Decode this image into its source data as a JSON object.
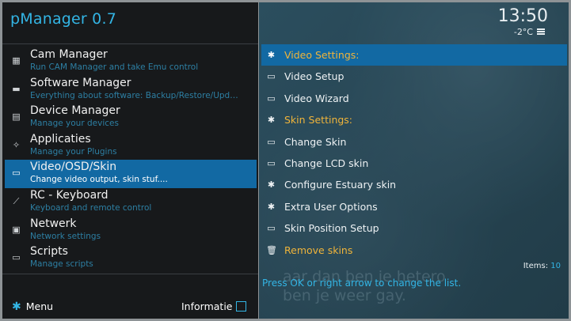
{
  "app": {
    "title": "pManager 0.7"
  },
  "status": {
    "clock": "13:50",
    "temperature": "-2°C"
  },
  "menu": [
    {
      "icon": "cam-icon",
      "title": "Cam Manager",
      "subtitle": "Run CAM Manager and take Emu control"
    },
    {
      "icon": "folder-icon",
      "title": "Software Manager",
      "subtitle": "Everything about software: Backup/Restore/Update..."
    },
    {
      "icon": "device-icon",
      "title": "Device Manager",
      "subtitle": "Manage your devices"
    },
    {
      "icon": "plugin-icon",
      "title": "Applicaties",
      "subtitle": "Manage your Plugins"
    },
    {
      "icon": "monitor-icon",
      "title": "Video/OSD/Skin",
      "subtitle": "Change video output, skin stuf....",
      "active": true
    },
    {
      "icon": "remote-icon",
      "title": "RC - Keyboard",
      "subtitle": "Keyboard and remote control"
    },
    {
      "icon": "network-icon",
      "title": "Netwerk",
      "subtitle": "Network settings"
    },
    {
      "icon": "script-icon",
      "title": "Scripts",
      "subtitle": "Manage scripts"
    }
  ],
  "footer": {
    "menu_label": "Menu",
    "info_label": "Informatie"
  },
  "submenu": [
    {
      "icon": "gear-icon",
      "label": "Video Settings:",
      "kind": "header",
      "active": true
    },
    {
      "icon": "video-icon",
      "label": "Video Setup"
    },
    {
      "icon": "video-icon",
      "label": "Video Wizard"
    },
    {
      "icon": "gear-icon",
      "label": "Skin Settings:",
      "kind": "header"
    },
    {
      "icon": "monitor-icon",
      "label": "Change Skin"
    },
    {
      "icon": "monitor-icon",
      "label": "Change LCD skin"
    },
    {
      "icon": "gear-icon",
      "label": "Configure Estuary skin"
    },
    {
      "icon": "gear-icon",
      "label": "Extra User Options"
    },
    {
      "icon": "monitor-icon",
      "label": "Skin Position Setup"
    },
    {
      "icon": "trash-icon",
      "label": "Remove skins",
      "kind": "warn"
    }
  ],
  "items": {
    "label": "Items:",
    "count": "10"
  },
  "hint": "Press OK or right arrow to change the list.",
  "background_text": [
    "aar dan ben je hetero",
    "ben je weer gay."
  ],
  "colors": {
    "accent": "#33b5e5",
    "highlight": "#1269a3",
    "header": "#f0b43a",
    "panel": "#17191b"
  }
}
